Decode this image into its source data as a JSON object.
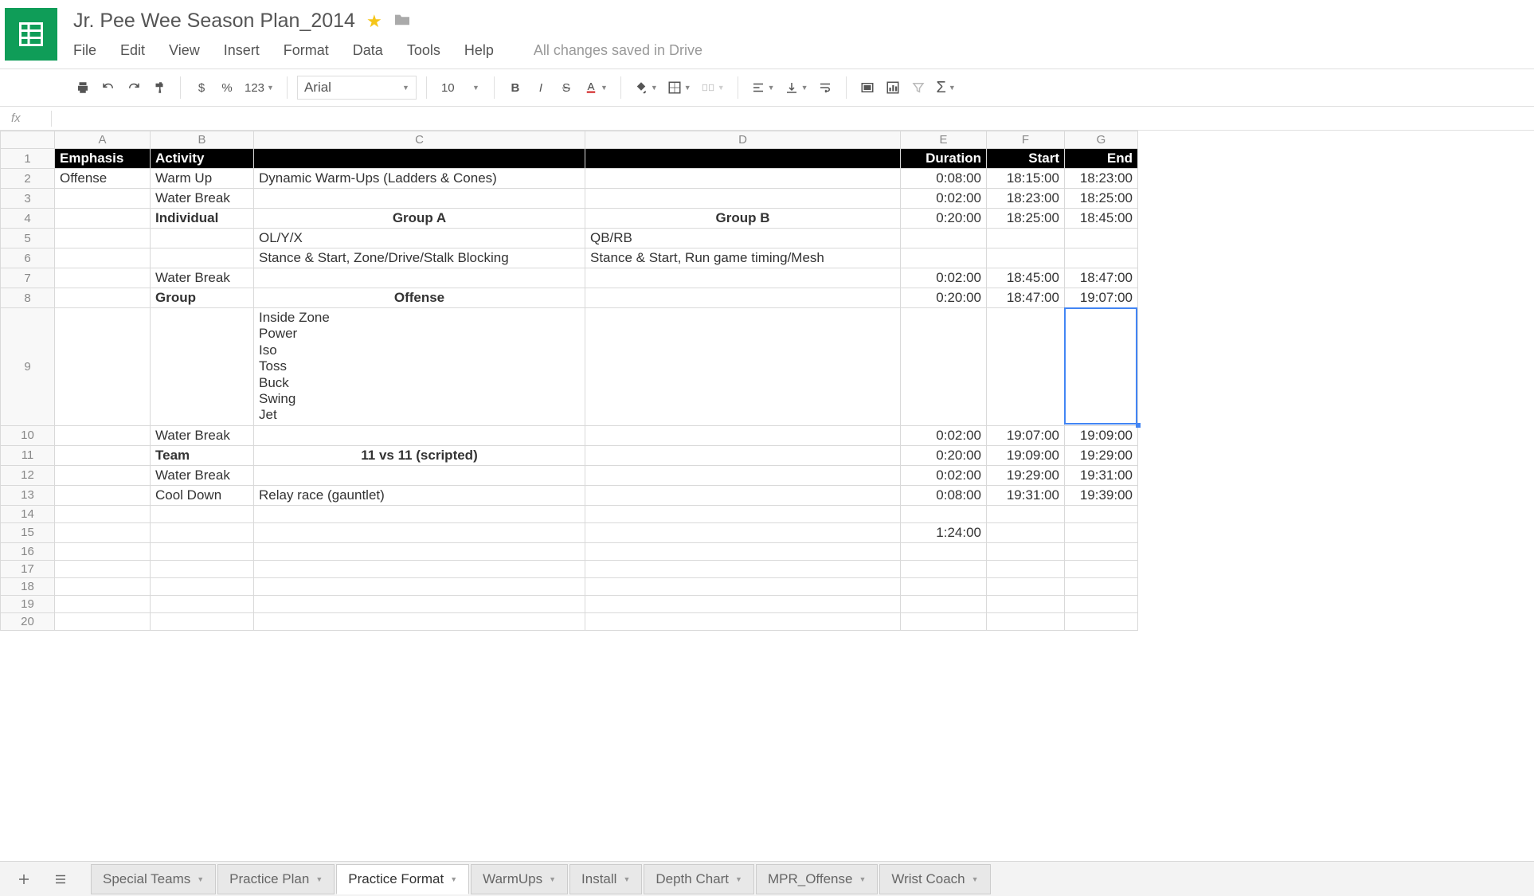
{
  "doc": {
    "title": "Jr. Pee Wee Season Plan_2014",
    "save_status": "All changes saved in Drive"
  },
  "menu": {
    "file": "File",
    "edit": "Edit",
    "view": "View",
    "insert": "Insert",
    "format": "Format",
    "data": "Data",
    "tools": "Tools",
    "help": "Help"
  },
  "toolbar": {
    "currency": "$",
    "percent": "%",
    "num_format": "123",
    "font": "Arial",
    "size": "10",
    "bold": "B",
    "italic": "I",
    "strike": "S",
    "sigma": "Σ"
  },
  "fx": {
    "label": "fx"
  },
  "cols": [
    "A",
    "B",
    "C",
    "D",
    "E",
    "F",
    "G"
  ],
  "rows": [
    {
      "n": "1",
      "cells": [
        "Emphasis",
        "Activity",
        "",
        "",
        "Duration",
        "Start",
        "End"
      ],
      "hdr": true
    },
    {
      "n": "2",
      "cells": [
        "Offense",
        "Warm Up",
        "Dynamic Warm-Ups (Ladders & Cones)",
        "",
        "0:08:00",
        "18:15:00",
        "18:23:00"
      ]
    },
    {
      "n": "3",
      "cells": [
        "",
        "Water Break",
        "",
        "",
        "0:02:00",
        "18:23:00",
        "18:25:00"
      ]
    },
    {
      "n": "4",
      "cells": [
        "",
        "Individual",
        "Group A",
        "Group B",
        "0:20:00",
        "18:25:00",
        "18:45:00"
      ],
      "boldB": true,
      "boldCD": true,
      "centerCD": true
    },
    {
      "n": "5",
      "cells": [
        "",
        "",
        "OL/Y/X",
        "QB/RB",
        "",
        "",
        ""
      ]
    },
    {
      "n": "6",
      "cells": [
        "",
        "",
        "Stance & Start, Zone/Drive/Stalk Blocking",
        "Stance & Start, Run game timing/Mesh",
        "",
        "",
        ""
      ]
    },
    {
      "n": "7",
      "cells": [
        "",
        "Water Break",
        "",
        "",
        "0:02:00",
        "18:45:00",
        "18:47:00"
      ]
    },
    {
      "n": "8",
      "cells": [
        "",
        "Group",
        "Offense",
        "",
        "0:20:00",
        "18:47:00",
        "19:07:00"
      ],
      "boldB": true,
      "boldCD": true,
      "centerCD": true
    },
    {
      "n": "9",
      "cells": [
        "",
        "",
        "Inside Zone\nPower\nIso\nToss\nBuck\nSwing\nJet",
        "",
        "",
        "",
        ""
      ],
      "tall": true
    },
    {
      "n": "10",
      "cells": [
        "",
        "Water Break",
        "",
        "",
        "0:02:00",
        "19:07:00",
        "19:09:00"
      ]
    },
    {
      "n": "11",
      "cells": [
        "",
        "Team",
        "11 vs 11 (scripted)",
        "",
        "0:20:00",
        "19:09:00",
        "19:29:00"
      ],
      "boldB": true,
      "boldCD": true,
      "centerCD": true
    },
    {
      "n": "12",
      "cells": [
        "",
        "Water Break",
        "",
        "",
        "0:02:00",
        "19:29:00",
        "19:31:00"
      ]
    },
    {
      "n": "13",
      "cells": [
        "",
        "Cool Down",
        "Relay race (gauntlet)",
        "",
        "0:08:00",
        "19:31:00",
        "19:39:00"
      ]
    },
    {
      "n": "14",
      "cells": [
        "",
        "",
        "",
        "",
        "",
        "",
        ""
      ]
    },
    {
      "n": "15",
      "cells": [
        "",
        "",
        "",
        "",
        "1:24:00",
        "",
        ""
      ]
    },
    {
      "n": "16",
      "cells": [
        "",
        "",
        "",
        "",
        "",
        "",
        ""
      ]
    },
    {
      "n": "17",
      "cells": [
        "",
        "",
        "",
        "",
        "",
        "",
        ""
      ]
    },
    {
      "n": "18",
      "cells": [
        "",
        "",
        "",
        "",
        "",
        "",
        ""
      ]
    },
    {
      "n": "19",
      "cells": [
        "",
        "",
        "",
        "",
        "",
        "",
        ""
      ]
    },
    {
      "n": "20",
      "cells": [
        "",
        "",
        "",
        "",
        "",
        "",
        ""
      ]
    }
  ],
  "tabs": [
    {
      "label": "Special Teams",
      "active": false
    },
    {
      "label": "Practice Plan",
      "active": false
    },
    {
      "label": "Practice Format",
      "active": true
    },
    {
      "label": "WarmUps",
      "active": false
    },
    {
      "label": "Install",
      "active": false
    },
    {
      "label": "Depth Chart",
      "active": false
    },
    {
      "label": "MPR_Offense",
      "active": false
    },
    {
      "label": "Wrist Coach",
      "active": false
    }
  ],
  "selected": {
    "row": 9,
    "col": "G"
  }
}
